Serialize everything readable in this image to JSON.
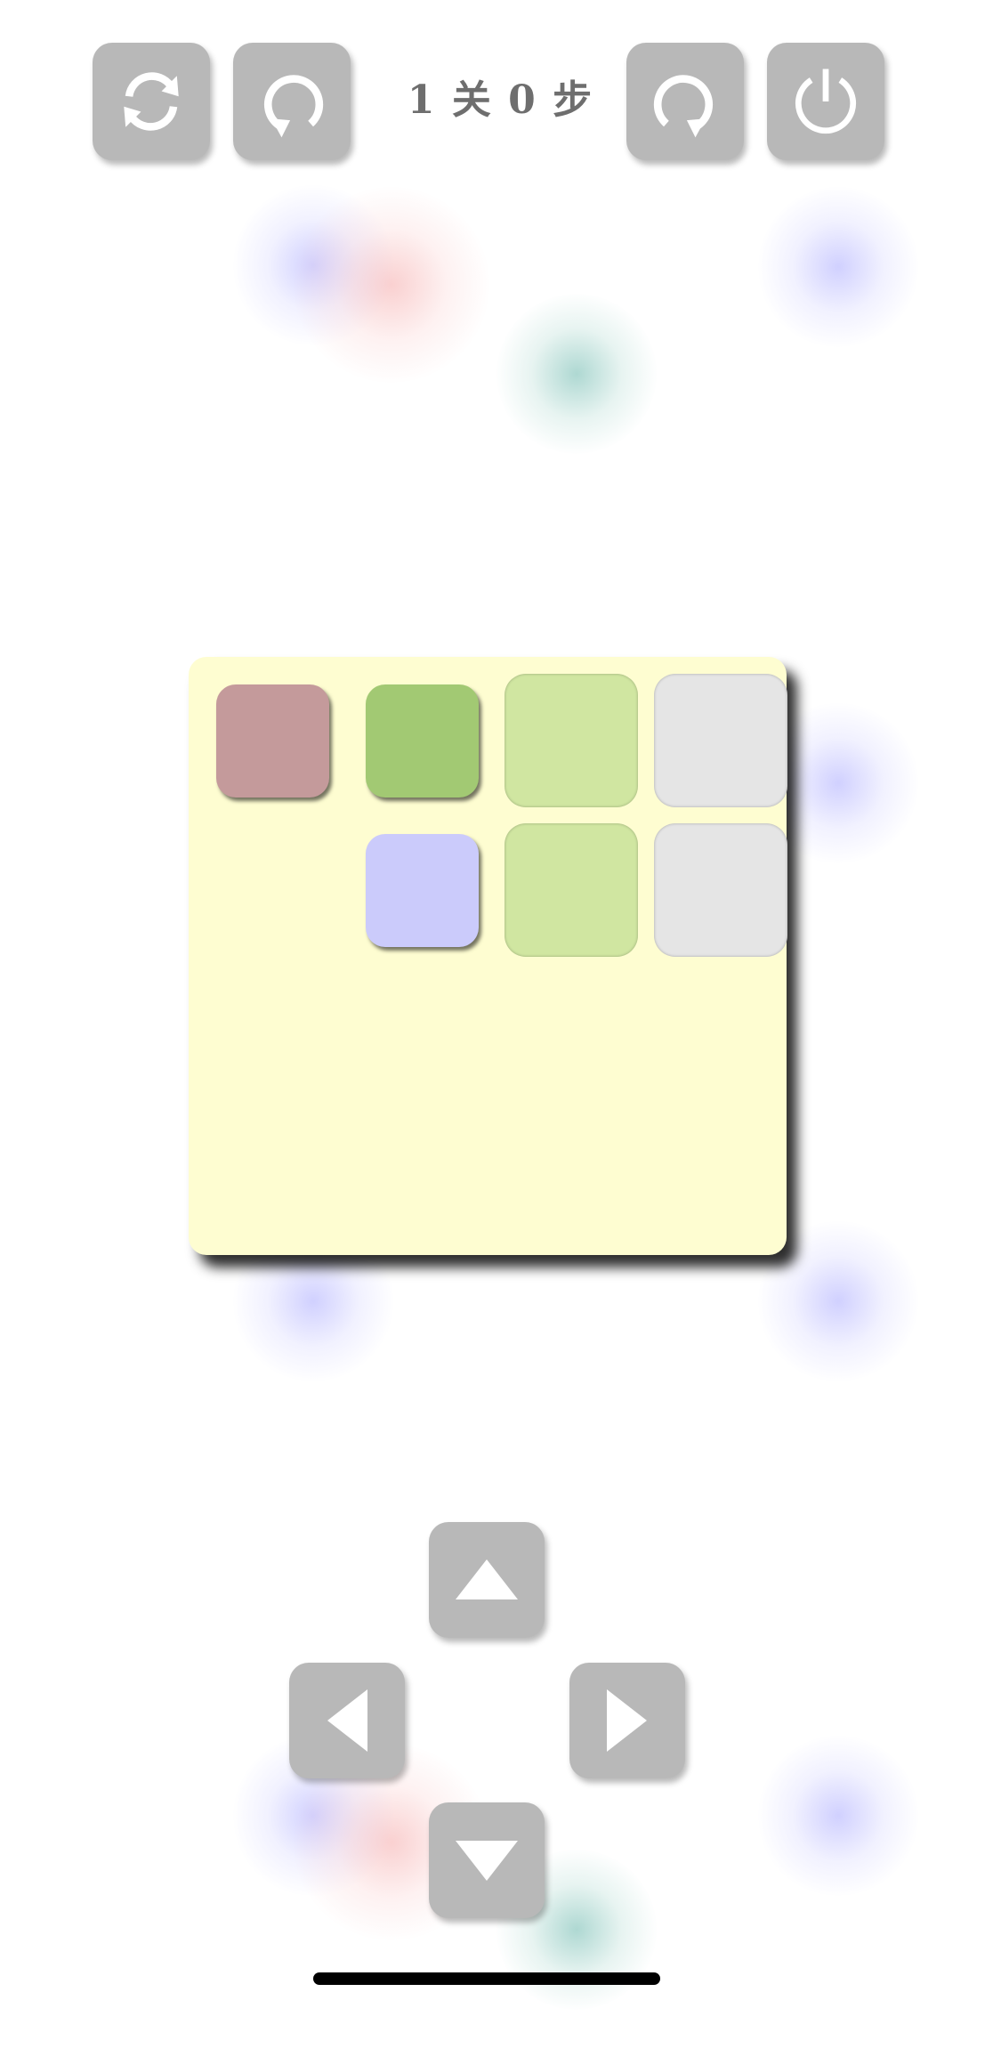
{
  "header": {
    "status_text": "1 关 0 步",
    "buttons": [
      {
        "name": "restart-button",
        "icon": "refresh-arrows-icon"
      },
      {
        "name": "undo-button",
        "icon": "undo-arrow-icon"
      },
      {
        "name": "redo-button",
        "icon": "redo-arrow-icon"
      },
      {
        "name": "power-button",
        "icon": "power-icon"
      }
    ]
  },
  "board": {
    "background": "#fefdd1",
    "pieces": [
      {
        "color": "#c49a9b",
        "row": 0,
        "col": 0
      },
      {
        "color": "#a2c973",
        "row": 0,
        "col": 1
      },
      {
        "color": "#cbcbfb",
        "row": 1,
        "col": 1
      }
    ],
    "targets": [
      {
        "color": "#d0e6a1",
        "row": 0,
        "col": 2
      },
      {
        "color": "#e5e5e5",
        "row": 0,
        "col": 3
      },
      {
        "color": "#d0e6a1",
        "row": 1,
        "col": 2
      },
      {
        "color": "#e5e5e5",
        "row": 1,
        "col": 3
      }
    ]
  },
  "controls": {
    "buttons": [
      {
        "name": "up-button",
        "icon": "triangle-up-icon"
      },
      {
        "name": "left-button",
        "icon": "triangle-left-icon"
      },
      {
        "name": "right-button",
        "icon": "triangle-right-icon"
      },
      {
        "name": "down-button",
        "icon": "triangle-down-icon"
      }
    ]
  },
  "colors": {
    "button_bg": "#b8b8b8",
    "icon": "#ffffff",
    "status_text": "#6e6e6e"
  }
}
